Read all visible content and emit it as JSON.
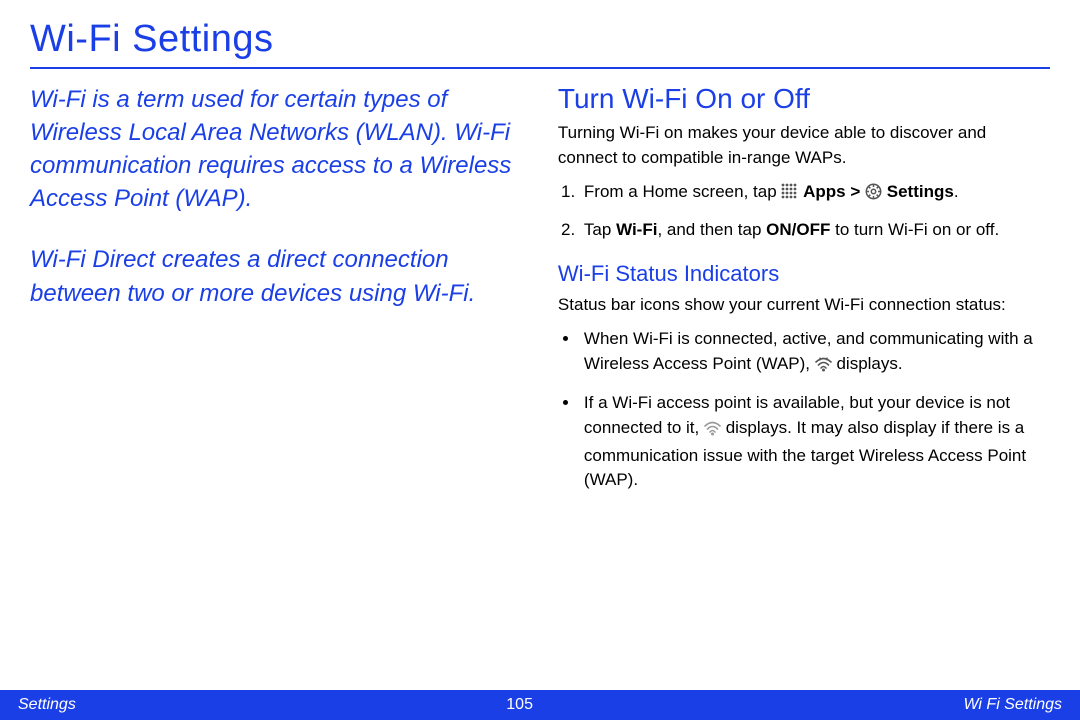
{
  "title": "Wi-Fi Settings",
  "intro": {
    "p1": "Wi-Fi is a term used for certain types of Wireless Local Area Networks (WLAN). Wi-Fi communication requires access to a Wireless Access Point (WAP).",
    "p2": "Wi-Fi Direct creates a direct connection between two or more devices using Wi-Fi."
  },
  "right": {
    "h2": "Turn Wi-Fi On or Off",
    "p1": "Turning Wi-Fi on makes your device able to discover and connect to compatible in-range WAPs.",
    "step1_pre": "From a Home screen, tap ",
    "apps_label": "Apps",
    "gt": " > ",
    "settings_label": "Settings",
    "step1_post": ".",
    "step2_a": "Tap ",
    "step2_wifi": "Wi-Fi",
    "step2_b": ", and then tap ",
    "step2_onoff": "ON/OFF",
    "step2_c": " to turn Wi-Fi on or off.",
    "h3": "Wi-Fi Status Indicators",
    "p2": "Status bar icons show your current Wi-Fi connection status:",
    "bul1_a": "When Wi-Fi is connected, active, and communicating with a Wireless Access Point (WAP), ",
    "bul1_b": " displays.",
    "bul2_a": "If a Wi-Fi access point is available, but your device is not connected to it, ",
    "bul2_b": " displays. It may also display if there is a communication issue with the target Wireless Access Point (WAP)."
  },
  "footer": {
    "left": "Settings",
    "center": "105",
    "right": "Wi Fi Settings"
  }
}
